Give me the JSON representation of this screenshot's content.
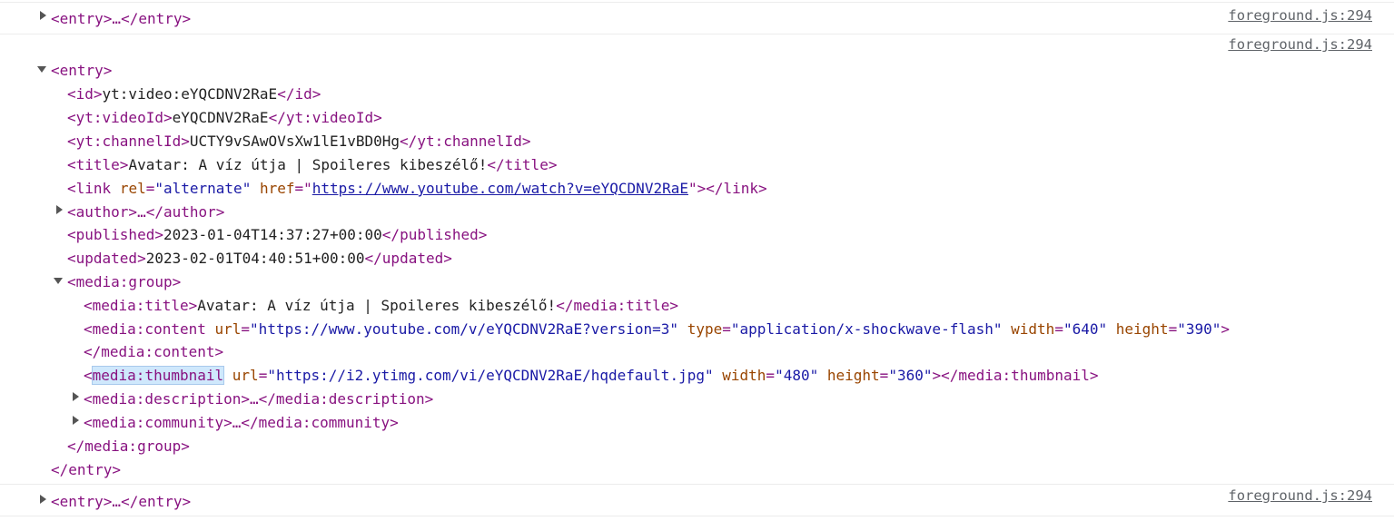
{
  "source_link": "foreground.js:294",
  "rows": {
    "r1": "<entry>…</entry>",
    "r3": "<entry>…</entry>"
  },
  "entry": {
    "open": "<entry>",
    "close": "</entry>",
    "id": {
      "open": "<id>",
      "text": "yt:video:eYQCDNV2RaE",
      "close": "</id>"
    },
    "videoId": {
      "open": "<yt:videoId>",
      "text": "eYQCDNV2RaE",
      "close": "</yt:videoId>"
    },
    "channelId": {
      "open": "<yt:channelId>",
      "text": "UCTY9vSAwOVsXw1lE1vBD0Hg",
      "close": "</yt:channelId>"
    },
    "title": {
      "open": "<title>",
      "text": "Avatar: A víz útja | Spoileres kibeszélő!",
      "close": "</title>"
    },
    "link": {
      "open": "<link",
      "rel_name": "rel",
      "rel_value": "\"alternate\"",
      "href_name": "href",
      "href_value": "https://www.youtube.com/watch?v=eYQCDNV2RaE",
      "close": "></link>"
    },
    "author": "<author>…</author>",
    "published": {
      "open": "<published>",
      "text": "2023-01-04T14:37:27+00:00",
      "close": "</published>"
    },
    "updated": {
      "open": "<updated>",
      "text": "2023-02-01T04:40:51+00:00",
      "close": "</updated>"
    },
    "media_group": {
      "open": "<media:group>",
      "close": "</media:group>",
      "title": {
        "open": "<media:title>",
        "text": "Avatar: A víz útja | Spoileres kibeszélő!",
        "close": "</media:title>"
      },
      "content": {
        "open": "<media:content",
        "url_name": "url",
        "url_value": "\"https://www.youtube.com/v/eYQCDNV2RaE?version=3\"",
        "type_name": "type",
        "type_value": "\"application/x-shockwave-flash\"",
        "width_name": "width",
        "width_value": "\"640\"",
        "height_name": "height",
        "height_value": "\"390\"",
        "open_end": ">",
        "close": "</media:content>"
      },
      "thumbnail": {
        "lt": "<",
        "tag": "media:thumbnail",
        "url_name": "url",
        "url_value": "\"https://i2.ytimg.com/vi/eYQCDNV2RaE/hqdefault.jpg\"",
        "width_name": "width",
        "width_value": "\"480\"",
        "height_name": "height",
        "height_value": "\"360\"",
        "close": "></media:thumbnail>"
      },
      "description": "<media:description>…</media:description>",
      "community": "<media:community>…</media:community>"
    }
  }
}
